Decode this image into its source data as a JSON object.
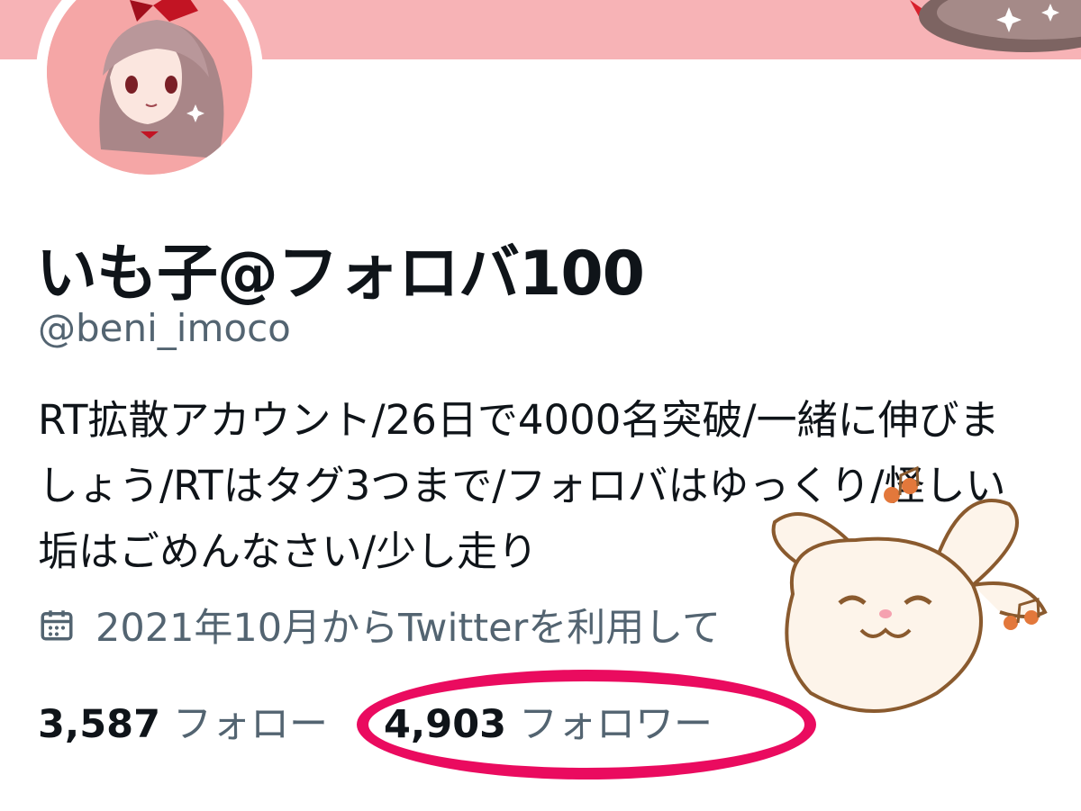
{
  "profile": {
    "display_name": "いも子@フォロバ100",
    "handle": "@beni_imoco",
    "bio": "RT拡散アカウント/26日で4000名突破/一緒に伸びましょう/RTはタグ3つまで/フォロバはゆっくり/怪しい垢はごめんなさい/少し走り",
    "joined": "2021年10月からTwitterを利用して",
    "following_count": "3,587",
    "following_label": "フォロー",
    "followers_count": "4,903",
    "followers_label": "フォロワー"
  },
  "icons": {
    "joined": "calendar-icon"
  },
  "colors": {
    "banner": "#f7b3b6",
    "avatar": "#f5a6a6",
    "highlight_circle": "#ea0b5f",
    "secondary_text": "#536471",
    "primary_text": "#0f1419"
  }
}
